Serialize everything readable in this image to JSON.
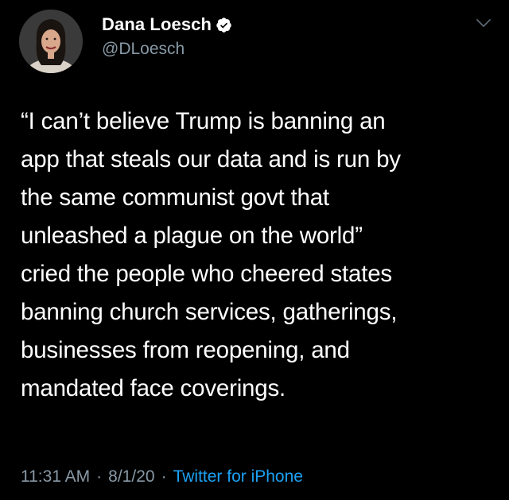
{
  "tweet": {
    "author": {
      "display_name": "Dana Loesch",
      "handle": "@DLoesch",
      "verified": true,
      "avatar_icon": "profile-photo"
    },
    "text": "“I can’t believe Trump is banning an\napp that steals our data and is run by\nthe same communist govt that\nunleashed a plague on the world”\ncried the people who cheered states\nbanning church services, gatherings,\nbusinesses from reopening, and\nmandated face coverings.",
    "time": "11:31 AM",
    "date": "8/1/20",
    "separator": "·",
    "source": "Twitter for iPhone",
    "menu_icon": "chevron-down-icon"
  },
  "colors": {
    "background": "#000000",
    "text": "#ffffff",
    "secondary_text": "#8899a6",
    "link": "#1da1f2",
    "verified_badge": "#ffffff"
  }
}
